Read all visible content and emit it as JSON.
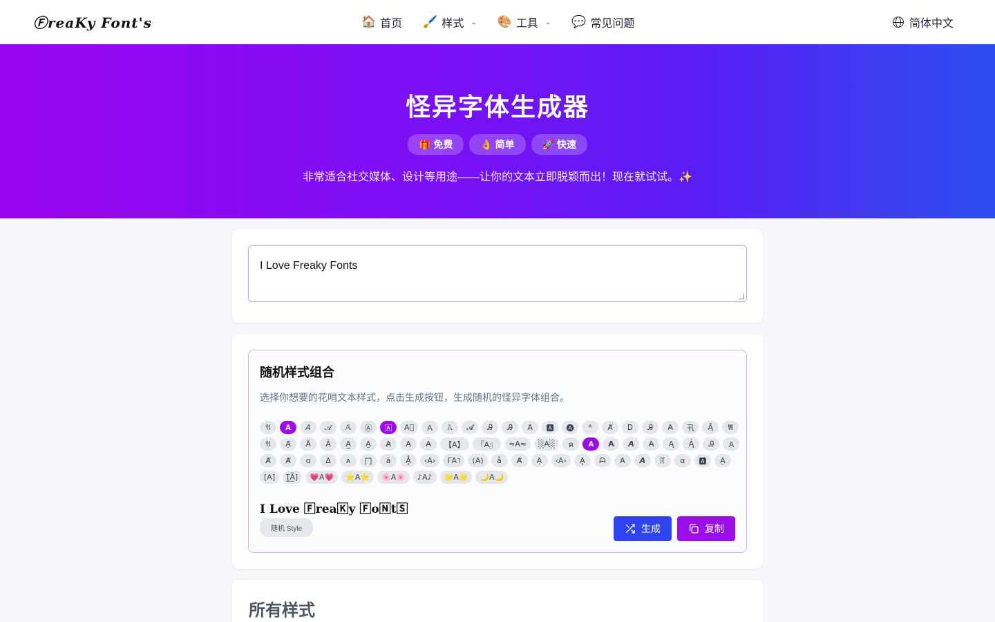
{
  "header": {
    "logo": "ⒻreaKy Font's",
    "nav": [
      {
        "emoji": "🏠",
        "label": "首页",
        "dropdown": false
      },
      {
        "emoji": "🖌️",
        "label": "样式",
        "dropdown": true
      },
      {
        "emoji": "🎨",
        "label": "工具",
        "dropdown": true
      },
      {
        "emoji": "💬",
        "label": "常见问题",
        "dropdown": false
      }
    ],
    "language": "简体中文"
  },
  "hero": {
    "title": "怪异字体生成器",
    "badges": [
      "🎁 免费",
      "👌 简单",
      "🚀 快速"
    ],
    "subtitle": "非常适合社交媒体、设计等用途——让你的文本立即脱颖而出！现在就试试。✨"
  },
  "input": {
    "value": "I Love Freaky Fonts"
  },
  "random": {
    "title": "随机样式组合",
    "description": "选择你想要的花哨文本样式，点击生成按钮，生成随机的怪异字体组合。",
    "chips": [
      {
        "label": "𝔄",
        "selected": false
      },
      {
        "label": "𝐀",
        "selected": true
      },
      {
        "label": "𝘈",
        "selected": false
      },
      {
        "label": "𝒜",
        "selected": false
      },
      {
        "label": "𝔸",
        "selected": false
      },
      {
        "label": "Ⓐ",
        "selected": false
      },
      {
        "label": "🄰",
        "selected": true
      },
      {
        "label": "A⃞",
        "selected": false
      },
      {
        "label": "Ａ",
        "selected": false
      },
      {
        "label": "𝙰",
        "selected": false
      },
      {
        "label": "𝓐",
        "selected": false
      },
      {
        "label": "Ꭿ",
        "selected": false
      },
      {
        "label": "Ꭿ",
        "selected": false
      },
      {
        "label": "A",
        "selected": false
      },
      {
        "label": "🅰",
        "selected": false
      },
      {
        "label": "🅐",
        "selected": false
      },
      {
        "label": "ᴬ",
        "selected": false
      },
      {
        "label": "Ⱥ",
        "selected": false
      },
      {
        "label": "Ꭰ",
        "selected": false
      },
      {
        "label": "Ꭿ",
        "selected": false
      },
      {
        "label": "A̶",
        "selected": false
      },
      {
        "label": "卂",
        "selected": false
      },
      {
        "label": "Ą̃",
        "selected": false
      },
      {
        "label": "𝕬",
        "selected": false
      },
      {
        "label": "𝔄",
        "selected": false
      },
      {
        "label": "Ạ̈",
        "selected": false
      },
      {
        "label": "Ä",
        "selected": false
      },
      {
        "label": "Ȧ",
        "selected": false
      },
      {
        "label": "A̲",
        "selected": false
      },
      {
        "label": "A̤",
        "selected": false
      },
      {
        "label": "A̷",
        "selected": false
      },
      {
        "label": "A̵",
        "selected": false
      },
      {
        "label": "A̶",
        "selected": false
      },
      {
        "label": "【A】",
        "selected": false
      },
      {
        "label": "『A』",
        "selected": false
      },
      {
        "label": "≈A≈",
        "selected": false
      },
      {
        "label": "░A░",
        "selected": false
      },
      {
        "label": "ค",
        "selected": false
      },
      {
        "label": "𝐀",
        "selected": true
      },
      {
        "label": "𝗔",
        "selected": false
      },
      {
        "label": "𝘼",
        "selected": false
      },
      {
        "label": "A̶",
        "selected": false
      },
      {
        "label": "Ą",
        "selected": false
      },
      {
        "label": "Ą̇",
        "selected": false
      },
      {
        "label": "Ꭿ",
        "selected": false
      },
      {
        "label": "Ａ",
        "selected": false
      },
      {
        "label": "Ⱥ",
        "selected": false
      },
      {
        "label": "Ⱥ",
        "selected": false
      },
      {
        "label": "ɑ",
        "selected": false
      },
      {
        "label": "Δ",
        "selected": false
      },
      {
        "label": "ᴀ",
        "selected": false
      },
      {
        "label": "冂",
        "selected": false
      },
      {
        "label": "ă",
        "selected": false
      },
      {
        "label": "A͓̽",
        "selected": false
      },
      {
        "label": "‹A›",
        "selected": false
      },
      {
        "label": "ΓA˥",
        "selected": false
      },
      {
        "label": "(A)",
        "selected": false
      },
      {
        "label": "å",
        "selected": false
      },
      {
        "label": "Ⱥ",
        "selected": false
      },
      {
        "label": "Ạ",
        "selected": false
      },
      {
        "label": "‹A›",
        "selected": false
      },
      {
        "label": "A͓",
        "selected": false
      },
      {
        "label": "ᗩ",
        "selected": false
      },
      {
        "label": "A",
        "selected": false
      },
      {
        "label": "𝘼",
        "selected": false
      },
      {
        "label": "ꍏ",
        "selected": false
      },
      {
        "label": "α",
        "selected": false
      },
      {
        "label": "🅰",
        "selected": false
      },
      {
        "label": "A̤",
        "selected": false
      },
      {
        "label": "[A]",
        "selected": false
      },
      {
        "label": "[̲̅A̲̅]",
        "selected": false
      },
      {
        "label": "💗A💗",
        "selected": false
      },
      {
        "label": "⭐A⭐",
        "selected": false
      },
      {
        "label": "🌸A🌸",
        "selected": false
      },
      {
        "label": "♪A♪",
        "selected": false
      },
      {
        "label": "🌟A🌟",
        "selected": false
      },
      {
        "label": "🌙A🌙",
        "selected": false
      }
    ],
    "preview": "I Love 🄵rea🄺y 🄵o🄽t🅂",
    "tag": "随机 Style",
    "generate_label": "生成",
    "copy_label": "复制"
  },
  "all_styles": {
    "title": "所有样式"
  }
}
